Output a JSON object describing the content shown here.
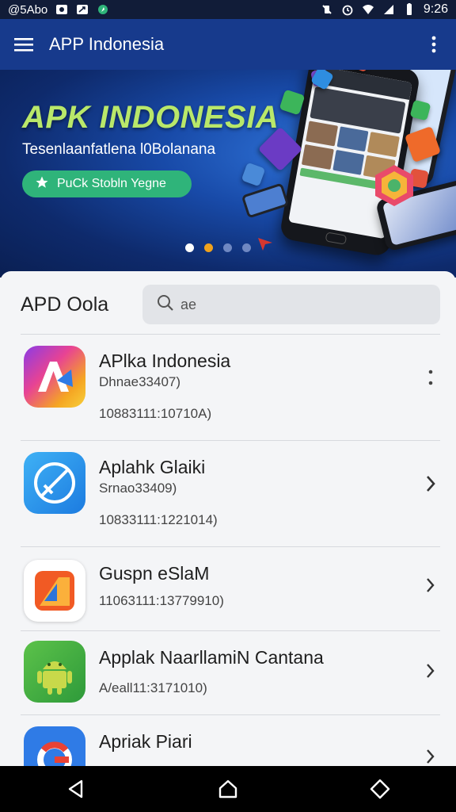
{
  "status_bar": {
    "left_text": "@5Abo",
    "time": "9:26",
    "icons": [
      "notification-icon",
      "cast-icon",
      "app-icon",
      "mute-icon",
      "alarm-icon",
      "wifi-icon",
      "signal-icon",
      "battery-icon"
    ]
  },
  "app_bar": {
    "title": "APP Indonesia",
    "menu_icon": "hamburger-menu-icon",
    "more_icon": "more-vertical-icon",
    "color": "#173a8c"
  },
  "banner": {
    "title": "APK INDONESIA",
    "subtitle": "Tesenlaanfatlena l0Bolanana",
    "cta_label": "PuCk Stobln Yegne",
    "cta_icon": "star-icon",
    "cta_color": "#2fb47a",
    "page_count": 4,
    "active_page": 1
  },
  "list": {
    "title": "APD Oola",
    "search": {
      "value": "ae",
      "placeholder": "",
      "icon": "search-icon"
    },
    "items": [
      {
        "name": "APlka Indonesia",
        "sub": "Dhnae33407)",
        "meta": "10883111:10710A)",
        "trailing": "kebab",
        "icon": "colorful-a-logo-icon"
      },
      {
        "name": "Aplahk Glaiki",
        "sub": "Srnao33409)",
        "meta": "10833111:1221014)",
        "trailing": "chevron",
        "icon": "blue-compass-logo-icon"
      },
      {
        "name": "Guspn eSlaM",
        "sub": "",
        "meta": "11063111:13779910)",
        "trailing": "chevron",
        "icon": "orange-shape-logo-icon"
      },
      {
        "name": "Applak NaarllamiN Cantana",
        "sub": "",
        "meta": "A/eall11:3171010)",
        "trailing": "chevron",
        "icon": "android-robot-icon"
      },
      {
        "name": "Apriak Piari",
        "sub": "",
        "meta": "",
        "trailing": "chevron",
        "icon": "google-style-logo-icon"
      }
    ]
  },
  "nav_bar": {
    "buttons": [
      "back-icon",
      "home-icon",
      "recents-icon"
    ]
  }
}
